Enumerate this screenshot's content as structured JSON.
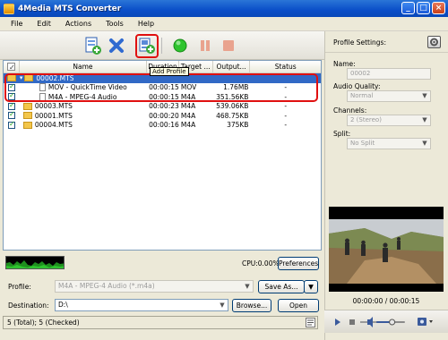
{
  "window": {
    "title": "4Media MTS Converter"
  },
  "menu": [
    "File",
    "Edit",
    "Actions",
    "Tools",
    "Help"
  ],
  "tooltip": "Add Profile",
  "list": {
    "headers": {
      "name": "Name",
      "duration": "Duration",
      "target": "Target ...",
      "output": "Output...",
      "status": "Status"
    },
    "rows": [
      {
        "name": "00002.MTS",
        "duration": "",
        "target": "",
        "output": "",
        "status": "",
        "kind": "group",
        "checked": false,
        "selected": true
      },
      {
        "name": "MOV - QuickTime Video",
        "duration": "00:00:15",
        "target": "MOV",
        "output": "1.76MB",
        "status": "-",
        "kind": "profile",
        "checked": true,
        "selected": false
      },
      {
        "name": "M4A - MPEG-4 Audio",
        "duration": "00:00:15",
        "target": "M4A",
        "output": "351.56KB",
        "status": "-",
        "kind": "profile",
        "checked": true,
        "selected": false
      },
      {
        "name": "00003.MTS",
        "duration": "00:00:23",
        "target": "M4A",
        "output": "539.06KB",
        "status": "-",
        "kind": "file",
        "checked": true,
        "selected": false
      },
      {
        "name": "00001.MTS",
        "duration": "00:00:20",
        "target": "M4A",
        "output": "468.75KB",
        "status": "-",
        "kind": "file",
        "checked": true,
        "selected": false
      },
      {
        "name": "00004.MTS",
        "duration": "00:00:16",
        "target": "M4A",
        "output": "375KB",
        "status": "-",
        "kind": "file",
        "checked": true,
        "selected": false
      }
    ]
  },
  "cpu": {
    "label": "CPU:0.00%"
  },
  "buttons": {
    "preferences": "Preferences",
    "save_as": "Save As...",
    "browse": "Browse...",
    "open": "Open"
  },
  "profile": {
    "label": "Profile:",
    "value": "M4A - MPEG-4 Audio (*.m4a)"
  },
  "destination": {
    "label": "Destination:",
    "value": "D:\\"
  },
  "status_bar": "5 (Total); 5 (Checked)",
  "profile_settings": {
    "title": "Profile Settings:",
    "name_label": "Name:",
    "name_value": "00002",
    "audio_quality_label": "Audio Quality:",
    "audio_quality_value": "Normal",
    "channels_label": "Channels:",
    "channels_value": "2 (Stereo)",
    "split_label": "Split:",
    "split_value": "No Split"
  },
  "player": {
    "time": "00:00:00 / 00:00:15",
    "volume": 0.55
  },
  "colors": {
    "title_bar": "#0a4ec8",
    "selected_row": "#3169c6",
    "highlight": "#e01010"
  }
}
